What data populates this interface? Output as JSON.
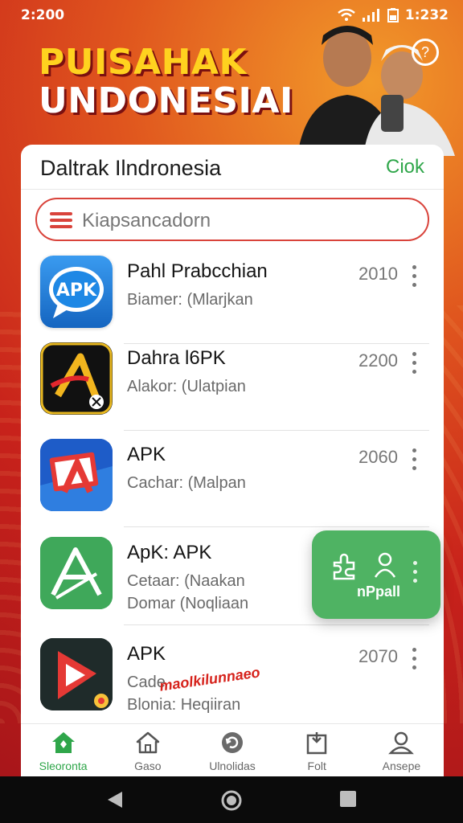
{
  "status_bar": {
    "time_left": "2:200",
    "time_right": "1:232"
  },
  "banner": {
    "title_line1": "PUISAHAK",
    "title_line2": "UNDONESIAI"
  },
  "card": {
    "title": "Daltrak Ilndronesia",
    "action_label": "Ciok"
  },
  "search": {
    "placeholder": "Kiapsancadorn"
  },
  "apps": [
    {
      "name": "Pahl Prabcchian",
      "sub1": "Biamer: (Mlarjkan",
      "sub2": "",
      "year": "2010",
      "icon": "apk-bubble-icon"
    },
    {
      "name": "Dahra l6PK",
      "sub1": "Alakor: (Ulatpian",
      "sub2": "",
      "year": "2200",
      "icon": "dana-icon"
    },
    {
      "name": "APK",
      "sub1": "Cachar: (Malpan",
      "sub2": "",
      "year": "2060",
      "icon": "card-icon"
    },
    {
      "name": "ApK: APK",
      "sub1": "Cetaar: (Naakan",
      "sub2": "Domar (Noqliaan",
      "year": "",
      "icon": "green-a-icon"
    },
    {
      "name": "APK",
      "sub1": "Cade",
      "sub2": "Blonia: Heqiiran",
      "year": "2070",
      "icon": "play-icon"
    }
  ],
  "overlay_stamp": "maolkilunnaeo",
  "fab": {
    "label": "nPpall"
  },
  "bottom_nav": [
    {
      "label": "Sleoronta",
      "icon": "home-icon",
      "active": true
    },
    {
      "label": "Gaso",
      "icon": "house-outline-icon",
      "active": false
    },
    {
      "label": "Ulnolidas",
      "icon": "refresh-icon",
      "active": false
    },
    {
      "label": "Folt",
      "icon": "box-icon",
      "active": false
    },
    {
      "label": "Ansepe",
      "icon": "profile-icon",
      "active": false
    }
  ],
  "colors": {
    "accent_green": "#2fa64a",
    "accent_red": "#d9433b",
    "banner_yellow": "#ffd21f"
  }
}
